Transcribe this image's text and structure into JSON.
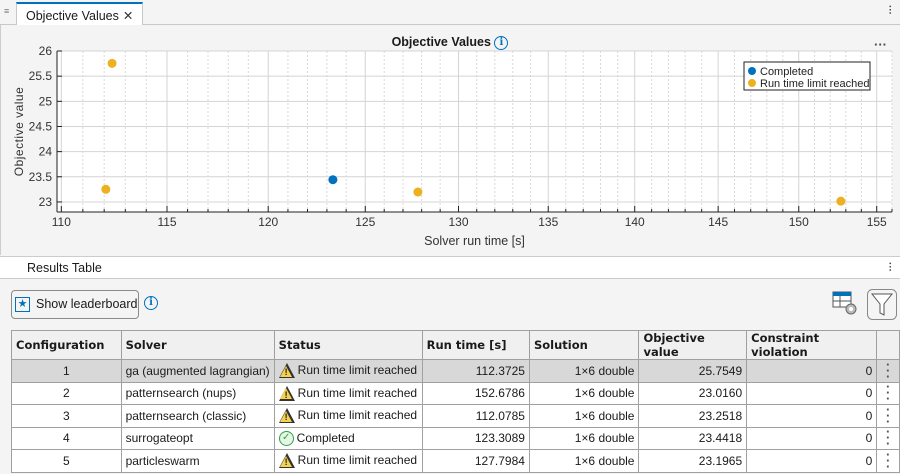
{
  "tab": {
    "title": "Objective Values",
    "close": "✕"
  },
  "plot": {
    "title": "Objective Values",
    "more": "···"
  },
  "chart_data": {
    "type": "scatter",
    "title": "Objective Values",
    "xlabel": "Solver run time [s]",
    "ylabel": "Objective value",
    "xscale": "log",
    "xlim": [
      109.8,
      156
    ],
    "ylim": [
      22.8,
      26
    ],
    "xticks": [
      110,
      115,
      120,
      125,
      130,
      135,
      140,
      145,
      150,
      155
    ],
    "yticks": [
      23,
      23.5,
      24,
      24.5,
      25,
      25.5,
      26
    ],
    "grid": true,
    "legend_position": "top-right",
    "series": [
      {
        "name": "Completed",
        "color": "#0072bd",
        "points": [
          [
            123.3089,
            23.4418
          ]
        ]
      },
      {
        "name": "Run time limit reached",
        "color": "#edb120",
        "points": [
          [
            112.3725,
            25.7549
          ],
          [
            152.6786,
            23.016
          ],
          [
            112.0785,
            23.2518
          ],
          [
            127.7984,
            23.1965
          ]
        ]
      }
    ]
  },
  "results": {
    "title": "Results Table",
    "leaderboard_label": "Show leaderboard",
    "columns": [
      "Configuration",
      "Solver",
      "Status",
      "Run time [s]",
      "Solution",
      "Objective value",
      "Constraint violation"
    ],
    "rows": [
      {
        "config": "1",
        "solver": "ga (augmented lagrangian)",
        "status": "Run time limit reached",
        "status_icon": "warning",
        "runtime": "112.3725",
        "solution": "1×6 double",
        "objective": "25.7549",
        "violation": "0"
      },
      {
        "config": "2",
        "solver": "patternsearch (nups)",
        "status": "Run time limit reached",
        "status_icon": "warning",
        "runtime": "152.6786",
        "solution": "1×6 double",
        "objective": "23.0160",
        "violation": "0"
      },
      {
        "config": "3",
        "solver": "patternsearch (classic)",
        "status": "Run time limit reached",
        "status_icon": "warning",
        "runtime": "112.0785",
        "solution": "1×6 double",
        "objective": "23.2518",
        "violation": "0"
      },
      {
        "config": "4",
        "solver": "surrogateopt",
        "status": "Completed",
        "status_icon": "check",
        "runtime": "123.3089",
        "solution": "1×6 double",
        "objective": "23.4418",
        "violation": "0"
      },
      {
        "config": "5",
        "solver": "particleswarm",
        "status": "Run time limit reached",
        "status_icon": "warning",
        "runtime": "127.7984",
        "solution": "1×6 double",
        "objective": "23.1965",
        "violation": "0"
      }
    ]
  }
}
